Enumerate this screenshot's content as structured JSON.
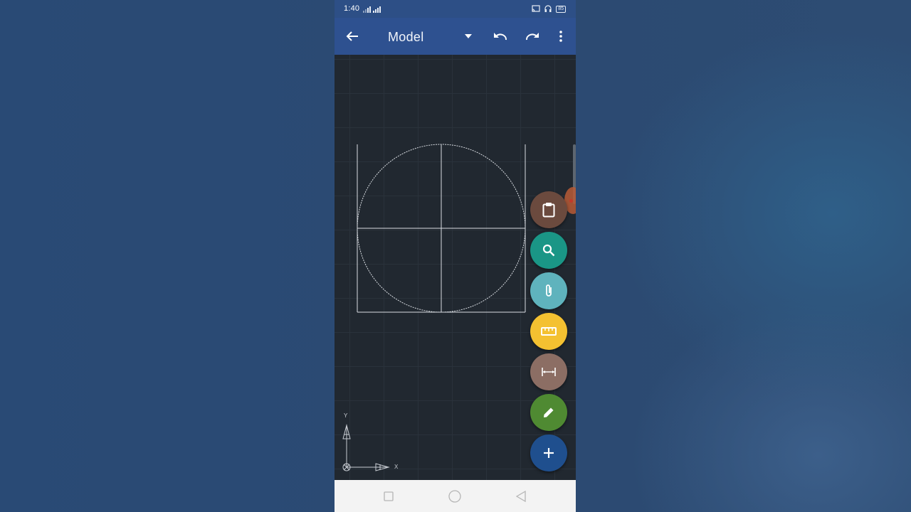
{
  "status_bar": {
    "time": "1:40",
    "battery": "85"
  },
  "toolbar": {
    "title": "Model",
    "icons": [
      "back-arrow-icon",
      "dropdown-arrow-icon",
      "undo-icon",
      "redo-icon",
      "more-vert-icon"
    ]
  },
  "canvas": {
    "axis_y_label": "Y",
    "axis_x_label": "X"
  },
  "fabs": [
    {
      "name": "clipboard-button",
      "icon": "clipboard-icon",
      "color": "#6b4a3e"
    },
    {
      "name": "search-button",
      "icon": "search-icon",
      "color": "#1a9686"
    },
    {
      "name": "attach-button",
      "icon": "paperclip-icon",
      "color": "#5fb3bd"
    },
    {
      "name": "measure-button",
      "icon": "ruler-icon",
      "color": "#f4c131"
    },
    {
      "name": "dimension-button",
      "icon": "dimension-icon",
      "color": "#8c6e64"
    },
    {
      "name": "draw-button",
      "icon": "pencil-icon",
      "color": "#4f8a32"
    },
    {
      "name": "add-button",
      "icon": "plus-icon",
      "color": "#1f4f8e"
    }
  ],
  "nav_bar": {
    "icons": [
      "recents-square-icon",
      "home-circle-icon",
      "back-triangle-icon"
    ]
  }
}
